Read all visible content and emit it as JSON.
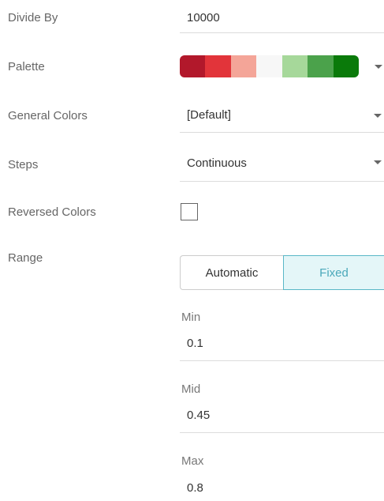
{
  "divide_by": {
    "label": "Divide By",
    "value": "10000"
  },
  "palette": {
    "label": "Palette",
    "swatches": [
      "#b2182b",
      "#e2343a",
      "#f4a598",
      "#f7f7f7",
      "#a6d89a",
      "#4ba24b",
      "#0a7a0a"
    ]
  },
  "general_colors": {
    "label": "General Colors",
    "value": "[Default]"
  },
  "steps": {
    "label": "Steps",
    "value": "Continuous"
  },
  "reversed_colors": {
    "label": "Reversed Colors",
    "checked": false
  },
  "range": {
    "label": "Range",
    "options": [
      "Automatic",
      "Fixed"
    ],
    "selected": "Fixed",
    "min": {
      "label": "Min",
      "value": "0.1"
    },
    "mid": {
      "label": "Mid",
      "value": "0.45"
    },
    "max": {
      "label": "Max",
      "value": "0.8"
    }
  },
  "colors": {
    "accent": "#4aa8ba",
    "accent_bg": "#e4f6f8",
    "label_text": "#666666"
  }
}
